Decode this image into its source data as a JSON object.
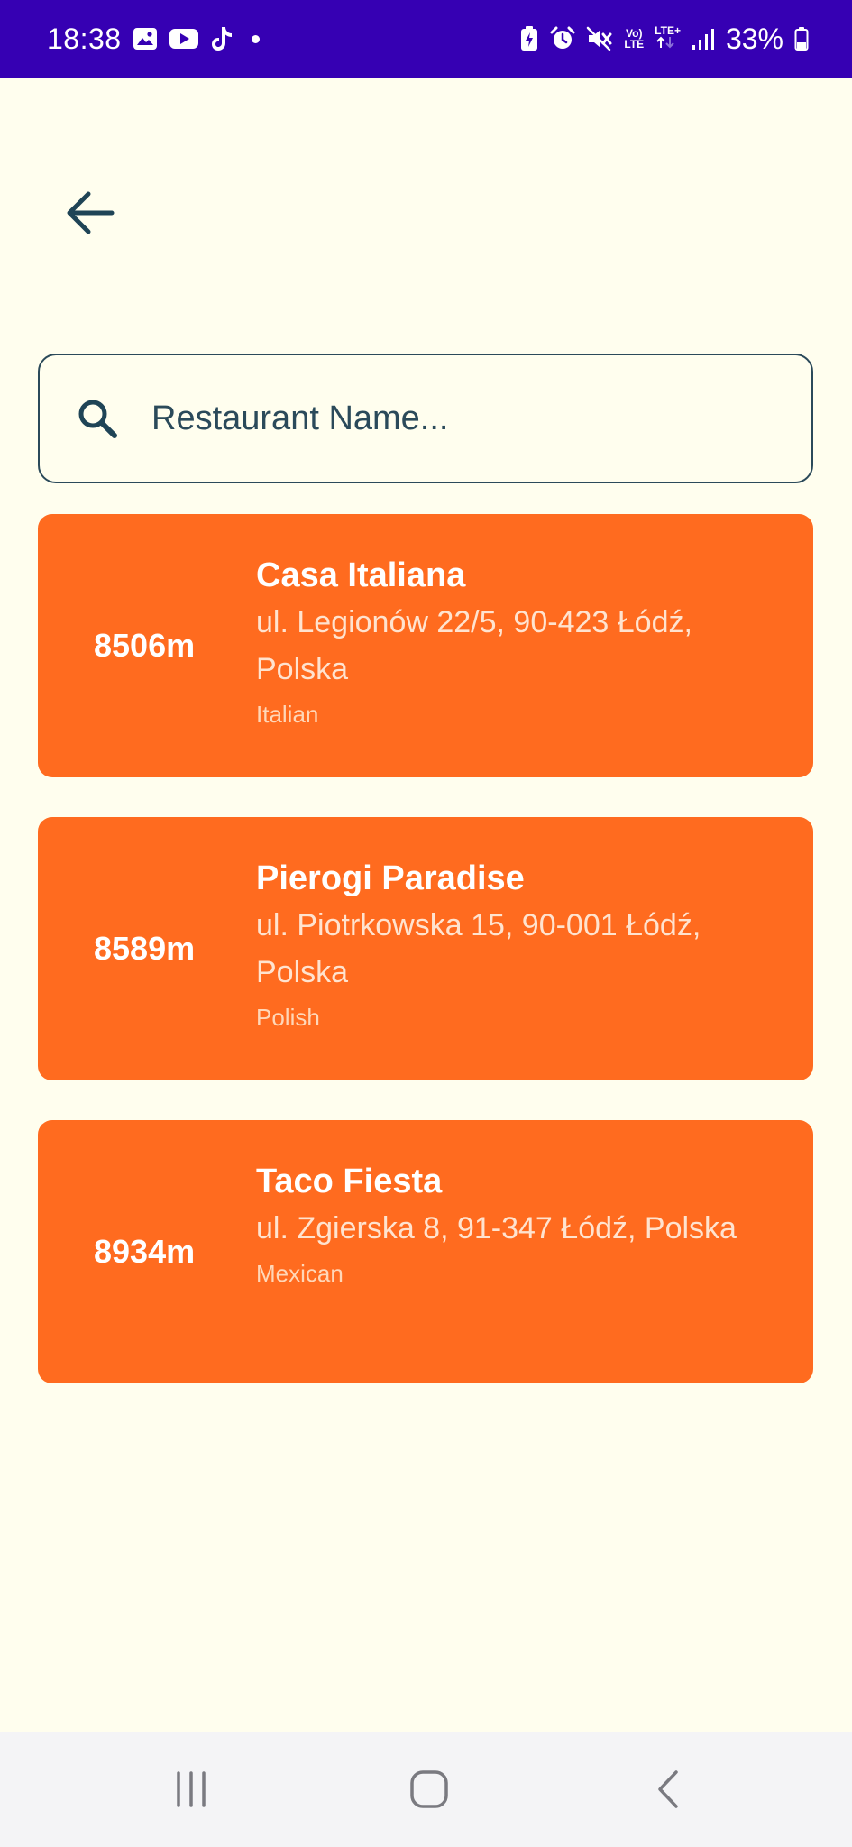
{
  "status_bar": {
    "time": "18:38",
    "battery_percent": "33%",
    "network_top": "Vo)",
    "network_bottom": "LTE",
    "network_type": "LTE+",
    "icons_left": [
      "gallery-icon",
      "youtube-icon",
      "tiktok-icon",
      "notification-dot"
    ],
    "icons_right": [
      "battery-saver-icon",
      "alarm-icon",
      "mute-icon",
      "volte-icon",
      "lte-plus-icon",
      "signal-icon",
      "battery-icon"
    ]
  },
  "header": {
    "back_icon": "arrow-left-icon"
  },
  "search": {
    "placeholder": "Restaurant Name...",
    "value": "",
    "icon": "search-icon"
  },
  "restaurants": [
    {
      "distance": "8506m",
      "name": "Casa Italiana",
      "address": "ul. Legionów 22/5, 90-423 Łódź, Polska",
      "cuisine": "Italian"
    },
    {
      "distance": "8589m",
      "name": "Pierogi Paradise",
      "address": "ul. Piotrkowska 15, 90-001 Łódź, Polska",
      "cuisine": "Polish"
    },
    {
      "distance": "8934m",
      "name": "Taco Fiesta",
      "address": "ul. Zgierska 8, 91-347 Łódź, Polska",
      "cuisine": "Mexican"
    }
  ],
  "nav_bar": {
    "icons": [
      "recent-apps-icon",
      "home-icon",
      "back-nav-icon"
    ]
  },
  "colors": {
    "status_bar": "#3600B3",
    "background": "#FFFEEE",
    "card": "#FF6B1F",
    "accent_dark": "#2B4A5A",
    "nav_bar": "#F4F4F6"
  }
}
